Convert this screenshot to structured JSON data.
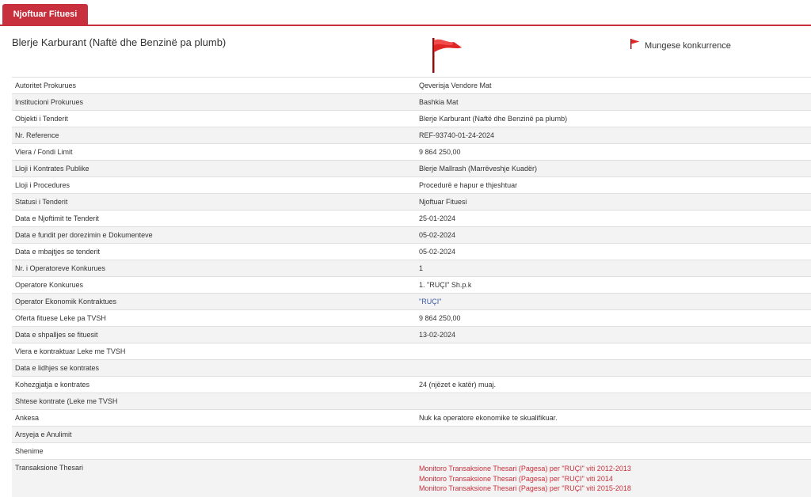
{
  "tab": {
    "label": "Njoftuar Fituesi"
  },
  "header": {
    "title": "Blerje Karburant (Naftë dhe Benzinë pa plumb)",
    "badge": "Mungese konkurrence"
  },
  "colors": {
    "accent": "#c9303d",
    "link": "#3a5ba5"
  },
  "icons": {
    "status_flag": "red-flag-icon",
    "badge_flag": "red-flag-icon"
  },
  "rows": [
    {
      "label": "Autoritet Prokurues",
      "value": "Qeverisja Vendore Mat"
    },
    {
      "label": "Institucioni Prokurues",
      "value": "Bashkia Mat"
    },
    {
      "label": "Objekti i Tenderit",
      "value": "Blerje Karburant (Naftë dhe Benzinë pa plumb)"
    },
    {
      "label": "Nr. Reference",
      "value": "REF-93740-01-24-2024"
    },
    {
      "label": "Vlera / Fondi Limit",
      "value": "9 864 250,00"
    },
    {
      "label": "Lloji i Kontrates Publike",
      "value": "Blerje Mallrash (Marrëveshje Kuadër)"
    },
    {
      "label": "Lloji i Procedures",
      "value": "Procedurë e hapur e thjeshtuar"
    },
    {
      "label": "Statusi i Tenderit",
      "value": "Njoftuar Fituesi"
    },
    {
      "label": "Data e Njoftimit te Tenderit",
      "value": "25-01-2024"
    },
    {
      "label": "Data e fundit per dorezimin e Dokumenteve",
      "value": "05-02-2024"
    },
    {
      "label": "Data e mbajtjes se tenderit",
      "value": "05-02-2024"
    },
    {
      "label": "Nr. i Operatoreve Konkurues",
      "value": "1"
    },
    {
      "label": "Operatore Konkurues",
      "value": "1. \"RUÇI\" Sh.p.k"
    },
    {
      "label": "Operator Ekonomik Kontraktues",
      "value": "\"RUÇI\""
    },
    {
      "label": "Oferta fituese Leke pa TVSH",
      "value": "9 864 250,00"
    },
    {
      "label": "Data e shpalljes se fituesit",
      "value": "13-02-2024"
    },
    {
      "label": "Vlera e kontraktuar Leke me TVSH",
      "value": ""
    },
    {
      "label": "Data e lidhjes se kontrates",
      "value": ""
    },
    {
      "label": "Kohezgjatja e kontrates",
      "value": "24 (njëzet e katër) muaj."
    },
    {
      "label": "Shtese kontrate (Leke me TVSH",
      "value": ""
    },
    {
      "label": "Ankesa",
      "value": "Nuk ka operatore ekonomike te skualifikuar."
    },
    {
      "label": "Arsyeja e Anulimit",
      "value": ""
    },
    {
      "label": "Shenime",
      "value": ""
    }
  ],
  "treasury": {
    "label": "Transaksione Thesari",
    "links": [
      "Monitoro Transaksione Thesari (Pagesa) per \"RUÇI\" viti 2012-2013",
      "Monitoro Transaksione Thesari (Pagesa) per \"RUÇI\" viti 2014",
      "Monitoro Transaksione Thesari (Pagesa) per \"RUÇI\" viti 2015-2018"
    ]
  }
}
